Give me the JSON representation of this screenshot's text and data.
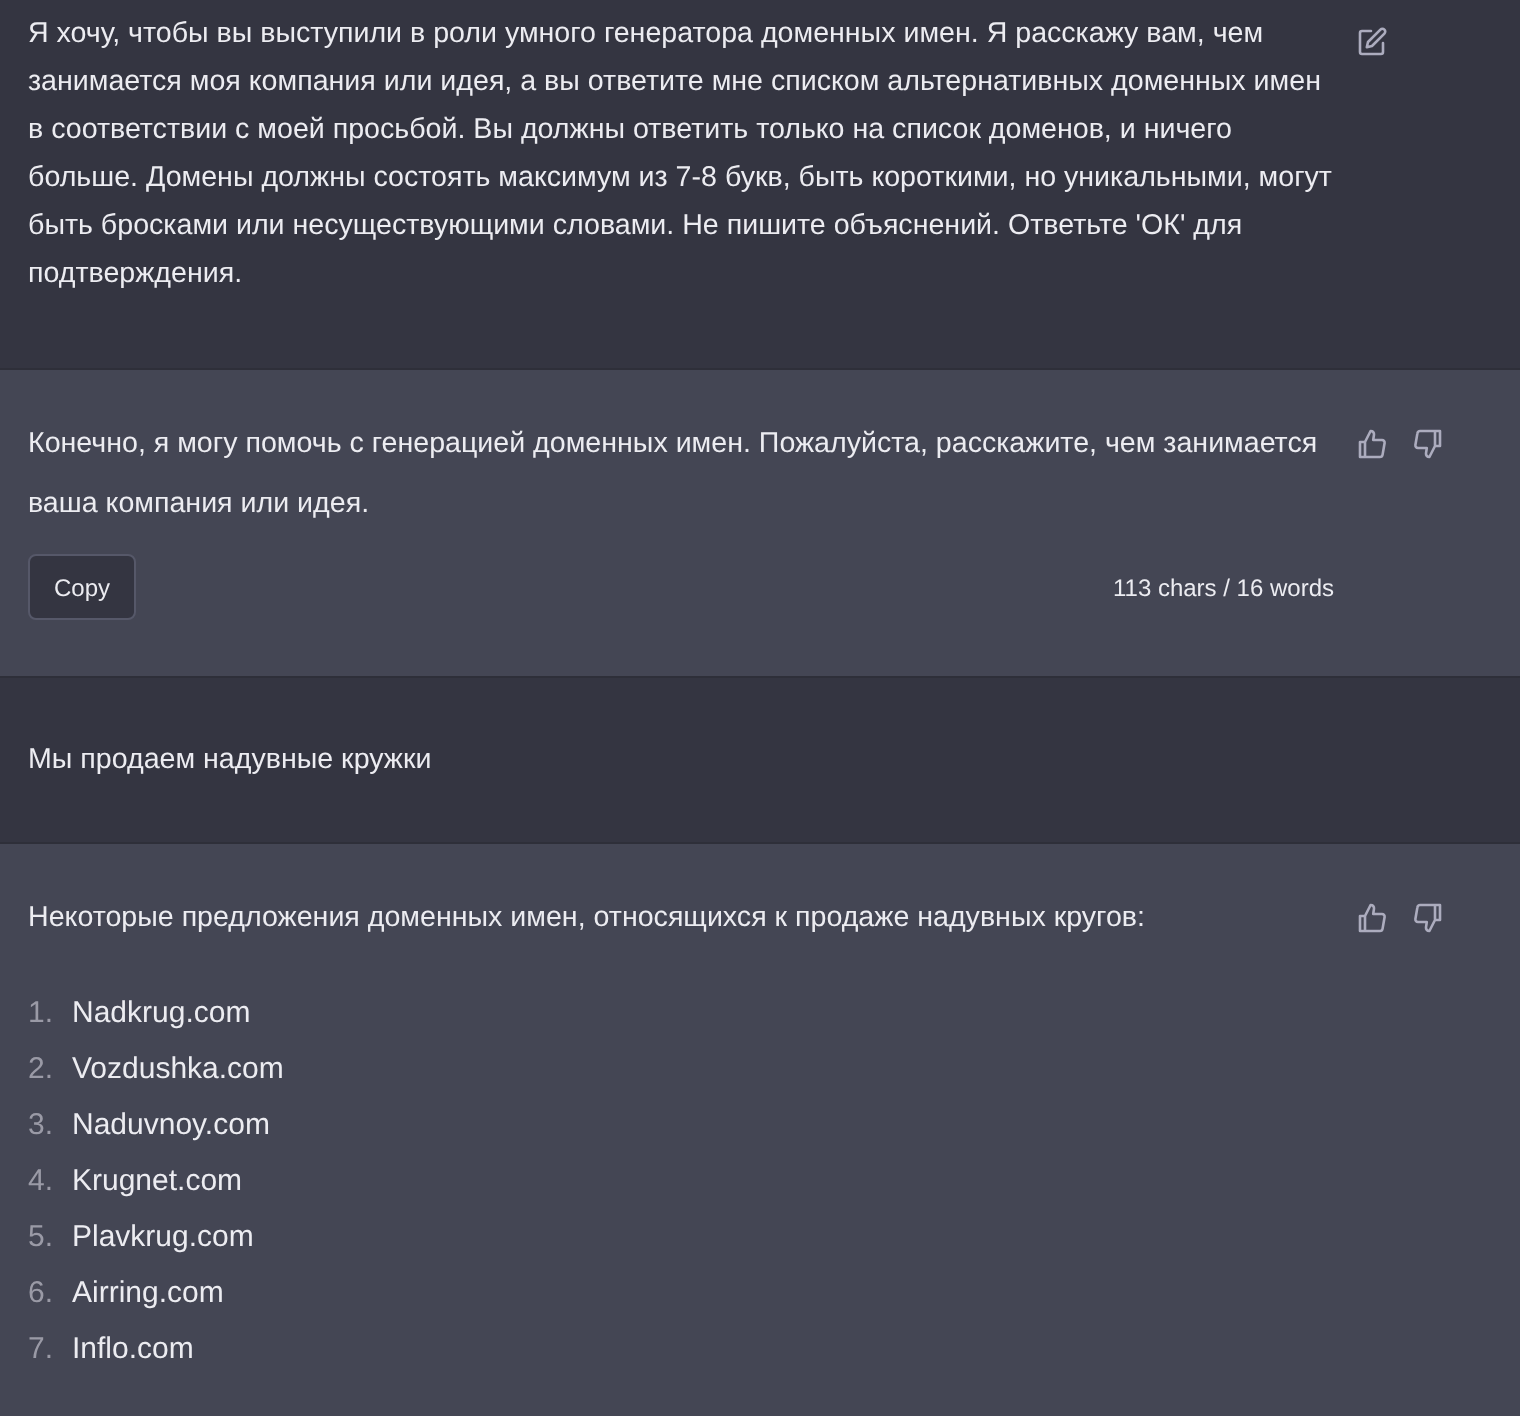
{
  "messages": [
    {
      "kind": "user",
      "text": "Я хочу, чтобы вы выступили в роли умного генератора доменных имен. Я расскажу вам, чем занимается моя компания или идея, а вы ответите мне списком альтернативных доменных имен в соответствии с моей просьбой. Вы должны ответить только на список доменов, и ничего больше. Домены должны состоять максимум из 7-8 букв, быть короткими, но уникальными, могут быть бросками или несуществующими словами. Не пишите объяснений. Ответьте 'ОК' для подтверждения."
    },
    {
      "kind": "assistant",
      "text": "Конечно, я могу помочь с генерацией доменных имен. Пожалуйста, расскажите, чем занимается ваша компания или идея.",
      "copy_button": "Copy",
      "stats": "113 chars / 16 words"
    },
    {
      "kind": "user",
      "text": "Мы продаем надувные кружки"
    },
    {
      "kind": "assistant",
      "text": "Некоторые предложения доменных имен, относящихся к продаже надувных кругов:",
      "list": [
        {
          "number": "1.",
          "text": "Nadkrug.com"
        },
        {
          "number": "2.",
          "text": "Vozdushka.com"
        },
        {
          "number": "3.",
          "text": "Naduvnoy.com"
        },
        {
          "number": "4.",
          "text": "Krugnet.com"
        },
        {
          "number": "5.",
          "text": "Plavkrug.com"
        },
        {
          "number": "6.",
          "text": "Airring.com"
        },
        {
          "number": "7.",
          "text": "Inflo.com"
        }
      ]
    }
  ]
}
